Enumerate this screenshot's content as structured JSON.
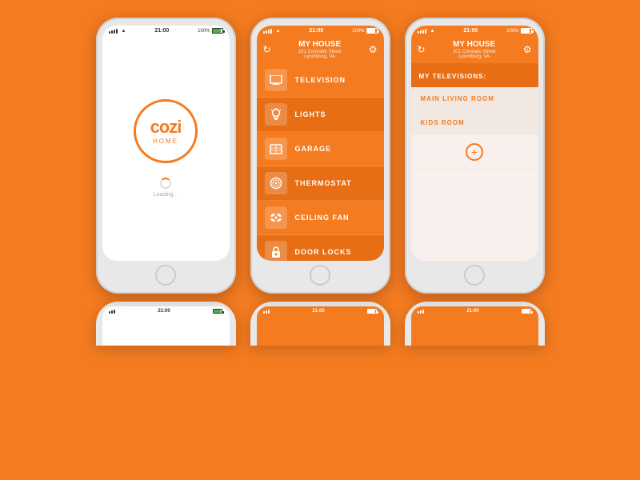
{
  "background_color": "#F47B20",
  "phones": [
    {
      "id": "phone-splash",
      "status_bar": {
        "left": "••••◦",
        "time": "21:00",
        "battery_pct": "100%",
        "theme": "light"
      },
      "content": "splash",
      "logo": {
        "text": "cozi",
        "sub": "HOME"
      },
      "loading_text": "Loading..."
    },
    {
      "id": "phone-menu",
      "status_bar": {
        "left": "••••◦",
        "time": "21:00",
        "battery_pct": "100%",
        "theme": "orange"
      },
      "header": {
        "title": "MY HOUSE",
        "subtitle1": "101 Colorado Street",
        "subtitle2": "Lynchburg, VA"
      },
      "menu_items": [
        {
          "icon": "tv",
          "label": "TELEVISION"
        },
        {
          "icon": "bulb",
          "label": "LIGHTS"
        },
        {
          "icon": "garage",
          "label": "GARAGE"
        },
        {
          "icon": "thermo",
          "label": "THERMOSTAT"
        },
        {
          "icon": "fan",
          "label": "CEILING FAN"
        },
        {
          "icon": "lock",
          "label": "DOOR LOCKS"
        }
      ]
    },
    {
      "id": "phone-tv",
      "status_bar": {
        "left": "••••◦",
        "time": "21:00",
        "battery_pct": "100%",
        "theme": "orange"
      },
      "header": {
        "title": "MY HOUSE",
        "subtitle1": "101 Colorado Street",
        "subtitle2": "Lynchburg, VA"
      },
      "section_title": "MY TELEVISIONS:",
      "tv_items": [
        "MAIN LIVING ROOM",
        "KIDS ROOM"
      ],
      "add_button": "+"
    }
  ],
  "bottom_phones": [
    {
      "id": "bottom-phone-1",
      "theme": "light"
    },
    {
      "id": "bottom-phone-2",
      "theme": "orange"
    },
    {
      "id": "bottom-phone-3",
      "theme": "orange"
    }
  ]
}
